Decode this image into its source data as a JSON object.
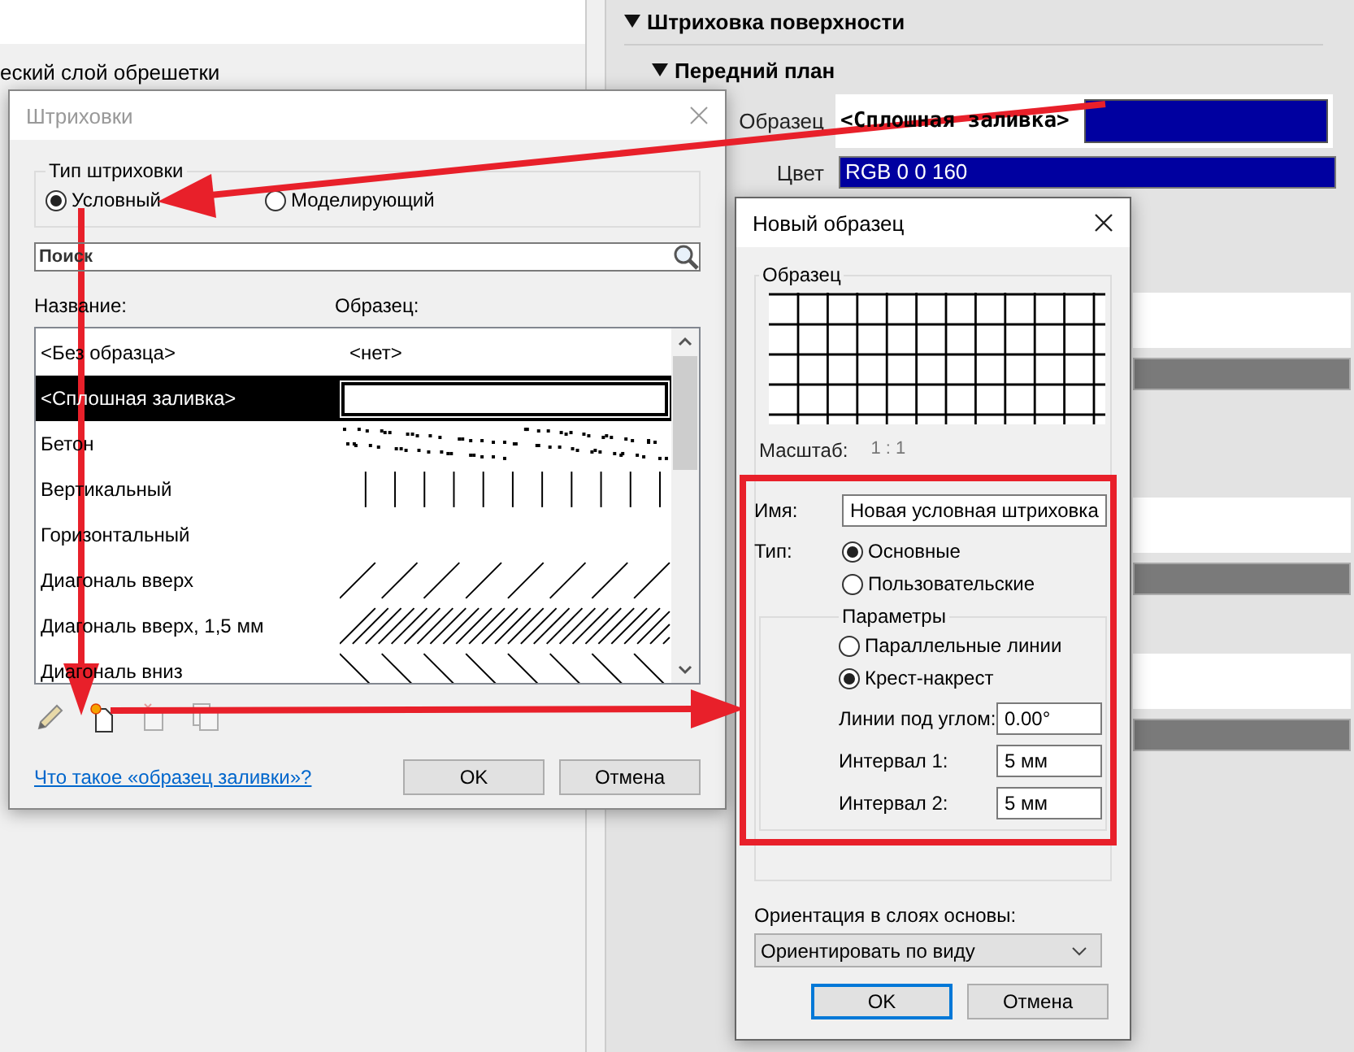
{
  "app": {
    "left_item": "еский слой обрешетки"
  },
  "properties": {
    "section": "Штриховка поверхности",
    "subsection": "Передний план",
    "rows": [
      {
        "kind": "pattern",
        "label": "Образец",
        "value": "<Сплошная заливка>",
        "color": "#0000a0"
      },
      {
        "kind": "color",
        "label": "Цвет",
        "value": "RGB 0 0 160",
        "color": "#0000a0"
      }
    ]
  },
  "hatch_dialog": {
    "title": "Штриховки",
    "type_group": {
      "label": "Тип штриховки",
      "options": [
        {
          "label": "Условный",
          "selected": true
        },
        {
          "label": "Моделирующий",
          "selected": false
        }
      ]
    },
    "search": {
      "placeholder": "Поиск"
    },
    "columns": [
      "Название:",
      "Образец:"
    ],
    "rows": [
      {
        "name": "<Без образца>",
        "sample": {
          "kind": "text",
          "text": "<нет>"
        },
        "selected": false
      },
      {
        "name": "<Сплошная заливка>",
        "sample": {
          "kind": "solid"
        },
        "selected": true
      },
      {
        "name": "Бетон",
        "sample": {
          "kind": "concrete"
        },
        "selected": false
      },
      {
        "name": "Вертикальный",
        "sample": {
          "kind": "vertical"
        },
        "selected": false
      },
      {
        "name": "Горизонтальный",
        "sample": {
          "kind": "blank"
        },
        "selected": false
      },
      {
        "name": "Диагональ вверх",
        "sample": {
          "kind": "diag_up"
        },
        "selected": false
      },
      {
        "name": "Диагональ вверх, 1,5 мм",
        "sample": {
          "kind": "diag_up_fine"
        },
        "selected": false
      },
      {
        "name": "Диагональ вниз",
        "sample": {
          "kind": "diag_down"
        },
        "selected": false
      }
    ],
    "tools": [
      {
        "kind": "pencil",
        "disabled": false
      },
      {
        "kind": "new",
        "disabled": false
      },
      {
        "kind": "delete",
        "disabled": true
      },
      {
        "kind": "copy",
        "disabled": true
      }
    ],
    "link": "Что такое «образец заливки»?",
    "buttons": [
      "OK",
      "Отмена"
    ]
  },
  "new_dialog": {
    "title": "Новый образец",
    "preview_label": "Образец",
    "scale_label": "Масштаб:",
    "scale": "1 : 1",
    "name_label": "Имя:",
    "name": "Новая условная штриховка",
    "type_label": "Тип:",
    "type_options": [
      {
        "label": "Основные",
        "selected": true
      },
      {
        "label": "Пользовательские",
        "selected": false
      }
    ],
    "params_label": "Параметры",
    "param_options": [
      {
        "label": "Параллельные линии",
        "selected": false
      },
      {
        "label": "Крест-накрест",
        "selected": true
      }
    ],
    "fields": [
      {
        "label": "Линии под углом:",
        "value": "0.00°"
      },
      {
        "label": "Интервал 1:",
        "value": "5 мм"
      },
      {
        "label": "Интервал 2:",
        "value": "5 мм"
      }
    ],
    "orientation_label": "Ориентация в слоях основы:",
    "orientation": "Ориентировать по виду",
    "buttons": [
      {
        "label": "OK",
        "focused": true
      },
      {
        "label": "Отмена",
        "focused": false
      }
    ]
  }
}
